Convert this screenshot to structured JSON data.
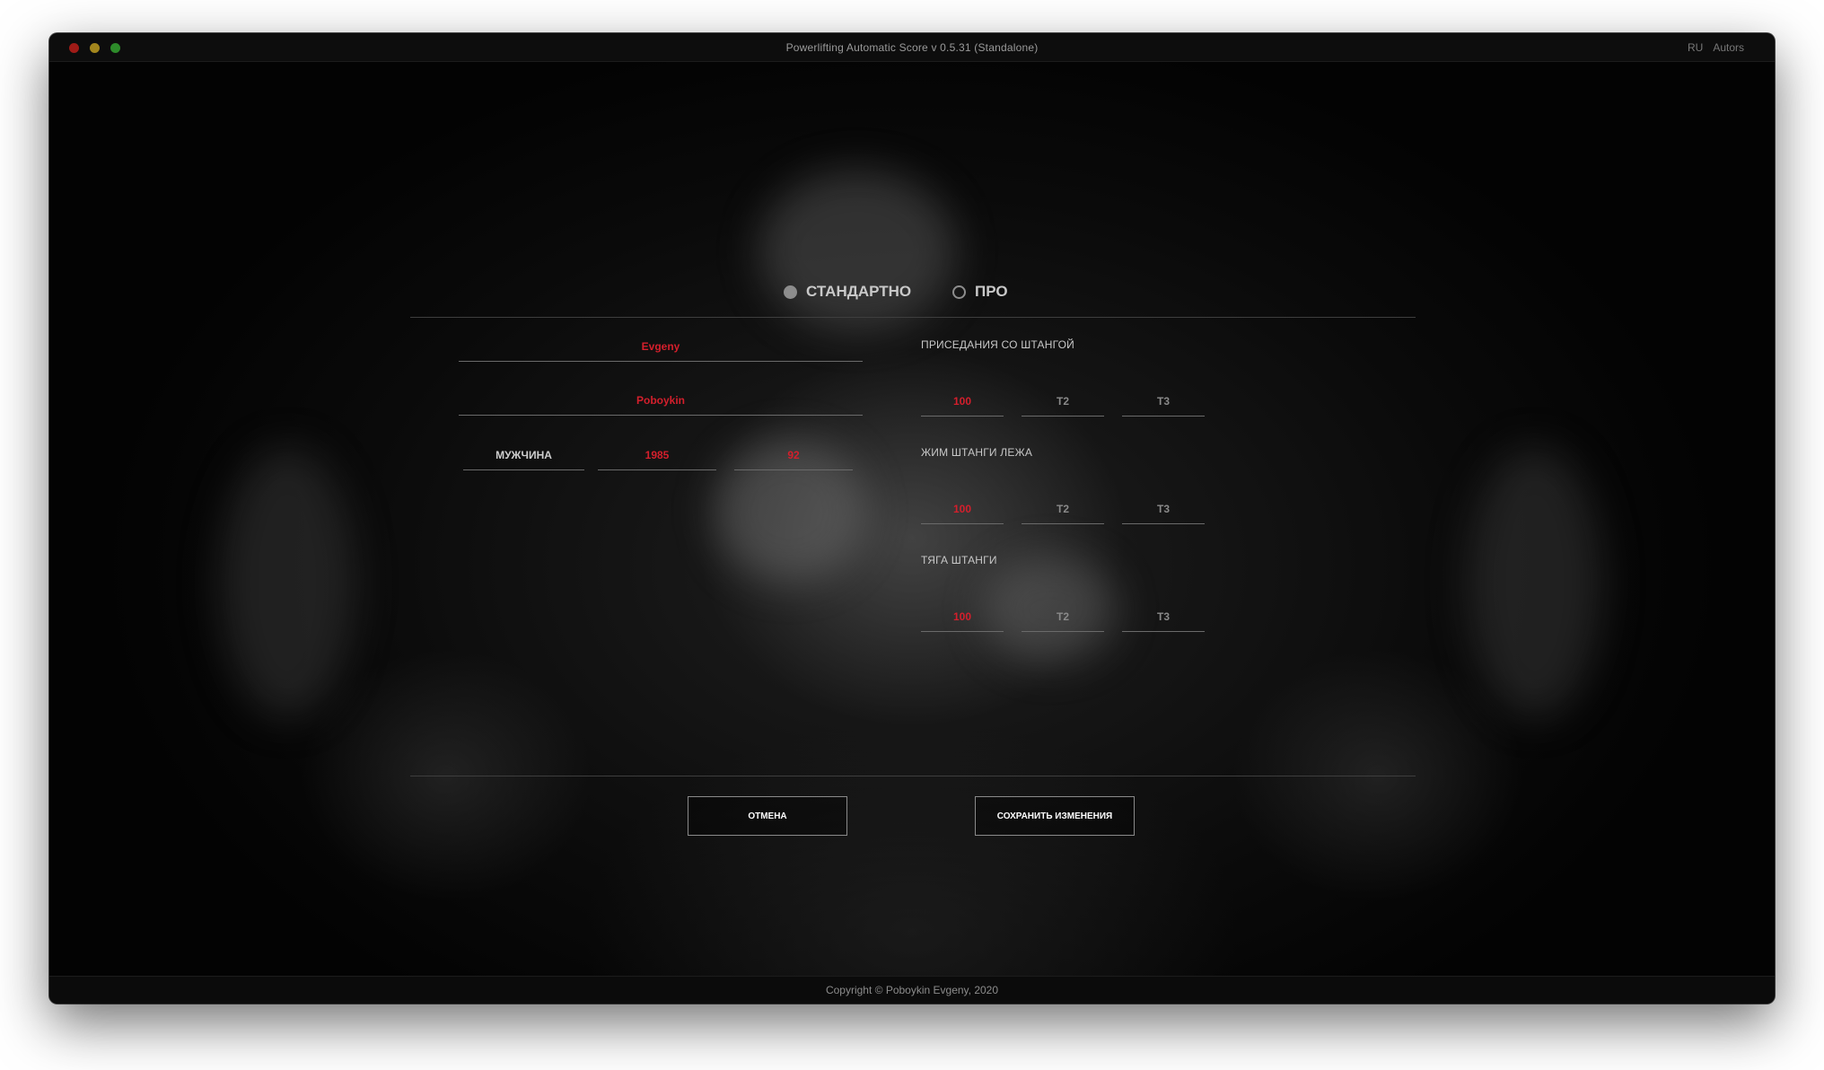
{
  "window": {
    "title": "Powerlifting Automatic Score v 0.5.31 (Standalone)",
    "menu": [
      "RU",
      "Autors"
    ]
  },
  "mode": {
    "options": [
      {
        "label": "СТАНДАРТНО",
        "selected": true
      },
      {
        "label": "ПРО",
        "selected": false
      }
    ]
  },
  "athlete": {
    "first_name": "Evgeny",
    "last_name": "Poboykin",
    "gender": "МУЖЧИНА",
    "birth_year": "1985",
    "weight": "92"
  },
  "lifts": [
    {
      "label": "ПРИСЕДАНИЯ СО ШТАНГОЙ",
      "attempts": [
        "100",
        "T2",
        "T3"
      ]
    },
    {
      "label": "ЖИМ ШТАНГИ ЛЕЖА",
      "attempts": [
        "100",
        "T2",
        "T3"
      ]
    },
    {
      "label": "ТЯГА ШТАНГИ",
      "attempts": [
        "100",
        "T2",
        "T3"
      ]
    }
  ],
  "buttons": {
    "cancel": "ОТМЕНА",
    "save": "СОХРАНИТЬ ИЗМЕНЕНИЯ"
  },
  "footer": {
    "copyright": "Copyright © Poboykin Evgeny, 2020"
  },
  "colors": {
    "accent": "#d41f2c",
    "background": "#050505",
    "text": "#c8c8c8"
  }
}
